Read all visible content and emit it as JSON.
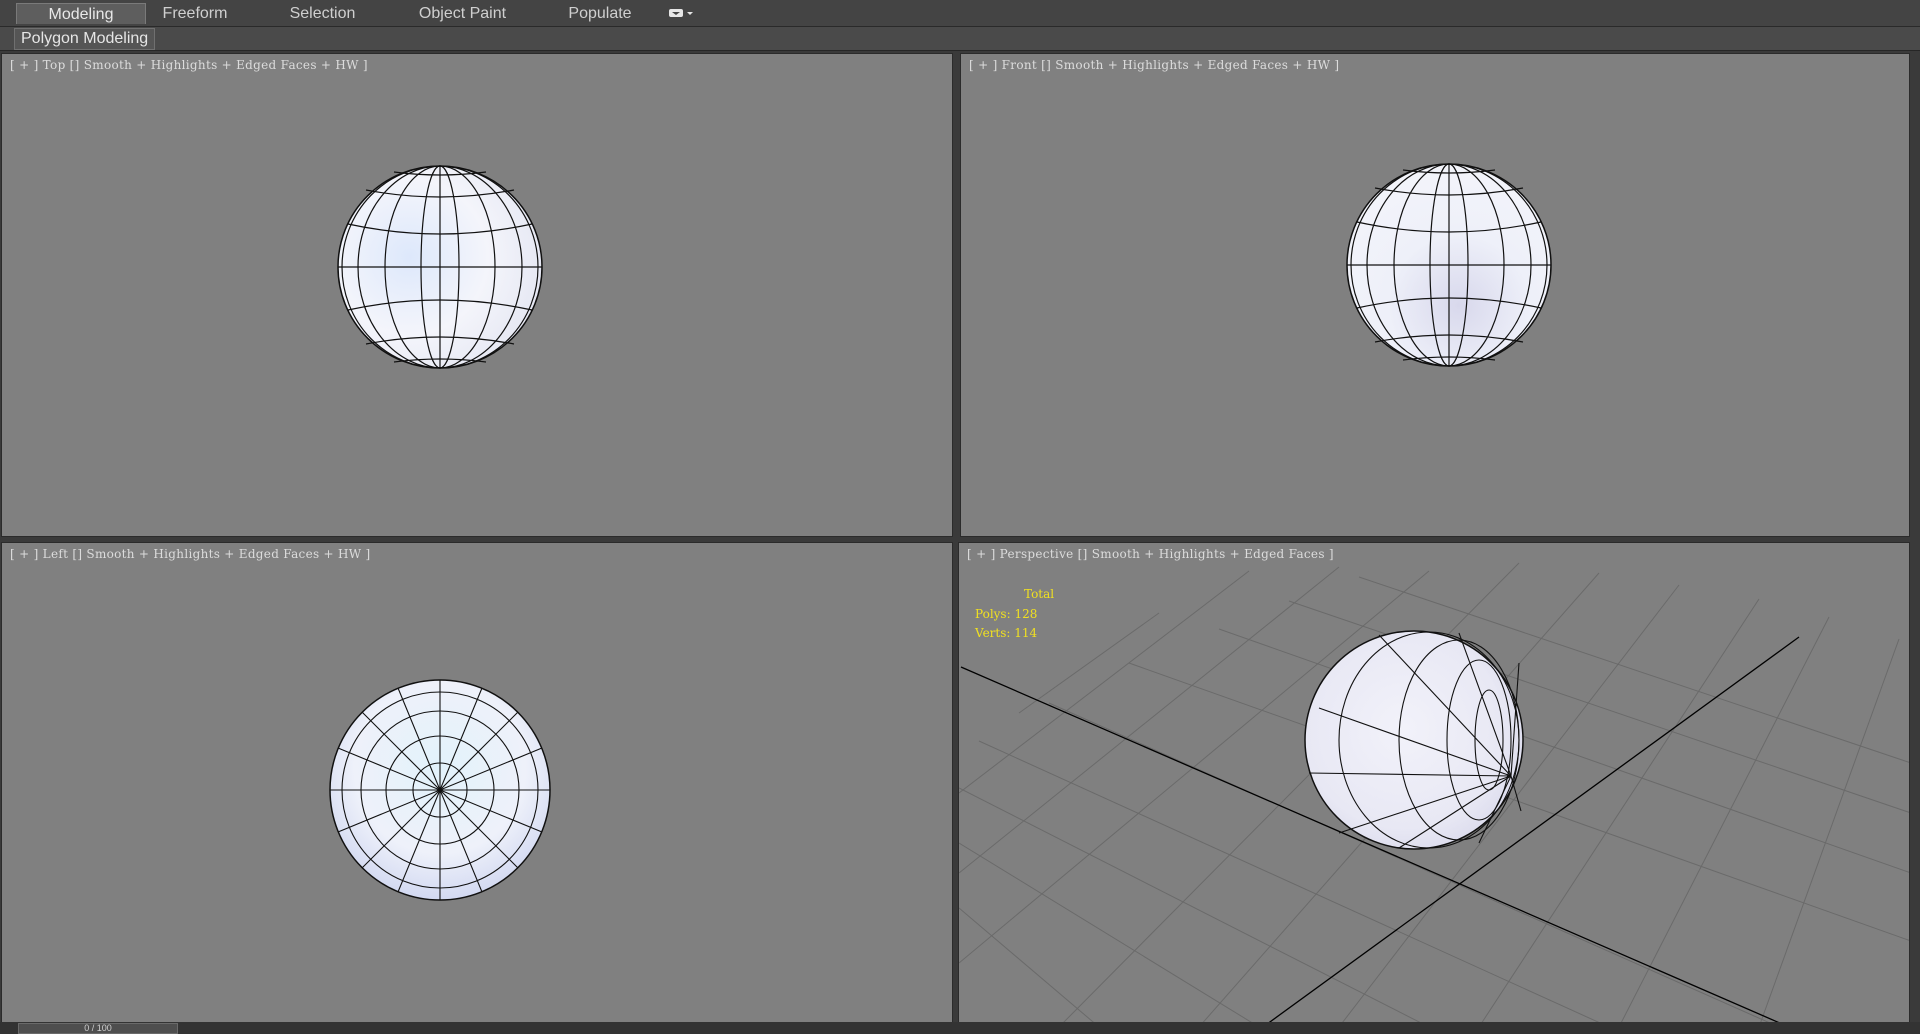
{
  "ribbon": {
    "tabs": [
      {
        "label": "Modeling",
        "active": true
      },
      {
        "label": "Freeform",
        "active": false
      },
      {
        "label": "Selection",
        "active": false
      },
      {
        "label": "Object Paint",
        "active": false
      },
      {
        "label": "Populate",
        "active": false
      }
    ],
    "toggle_icon": "ribbon-minimize-icon",
    "panel_label": "Polygon Modeling"
  },
  "viewports": {
    "top": {
      "plus": "[ + ]",
      "view": "Top",
      "shading": "Smooth + Highlights + Edged Faces + HW ]"
    },
    "front": {
      "plus": "[ + ]",
      "view": "Front",
      "shading": "Smooth + Highlights + Edged Faces + HW ]"
    },
    "left": {
      "plus": "[ + ]",
      "view": "Left",
      "shading": "Smooth + Highlights + Edged Faces + HW ]"
    },
    "perspective": {
      "plus": "[ + ]",
      "view": "Perspective",
      "shading": "Smooth + Highlights + Edged Faces ]",
      "stats": {
        "title": "Total",
        "polys": "Polys: 128",
        "verts": "Verts: 114"
      }
    }
  },
  "timeline": {
    "slider_text": "0 / 100"
  },
  "colors": {
    "viewport_bg": "#808080",
    "sphere_fill": "#eaeef8",
    "stats_text": "#f0e020"
  }
}
